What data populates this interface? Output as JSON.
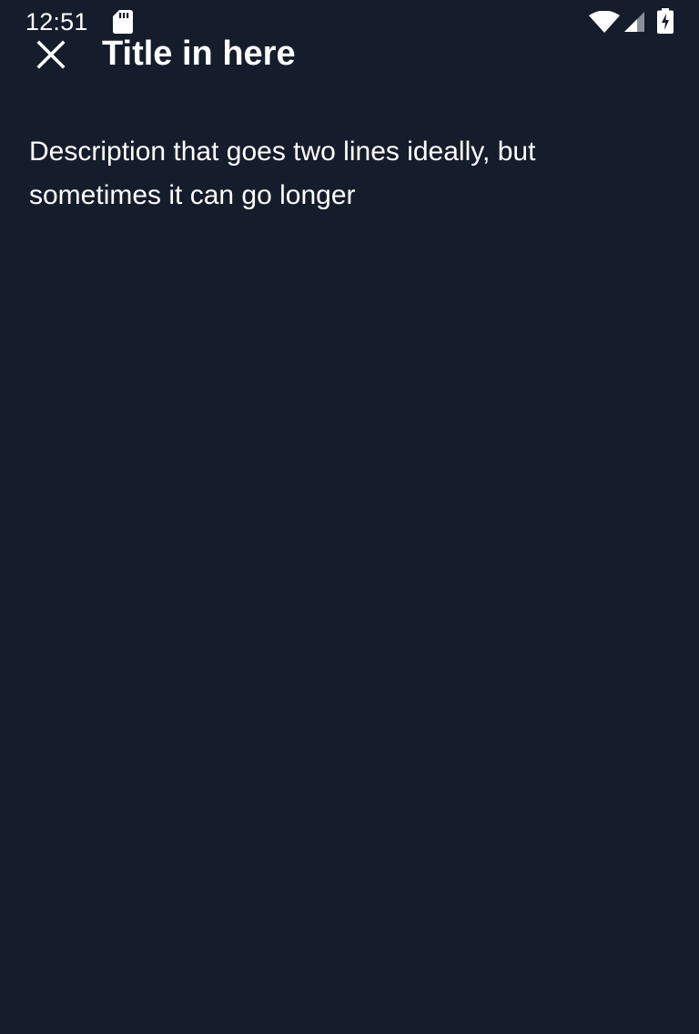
{
  "status_bar": {
    "time": "12:51",
    "icons": [
      "sd-card-icon",
      "wifi-icon",
      "cell-signal-icon",
      "battery-charging-icon"
    ]
  },
  "app_bar": {
    "close_icon": "close-icon",
    "title": "Title in here"
  },
  "content": {
    "description": "Description that goes two lines ideally, but sometimes it can go longer"
  },
  "colors": {
    "background": "#151d2c",
    "text": "#ffffff",
    "signal_dim": "#8a8f99"
  }
}
